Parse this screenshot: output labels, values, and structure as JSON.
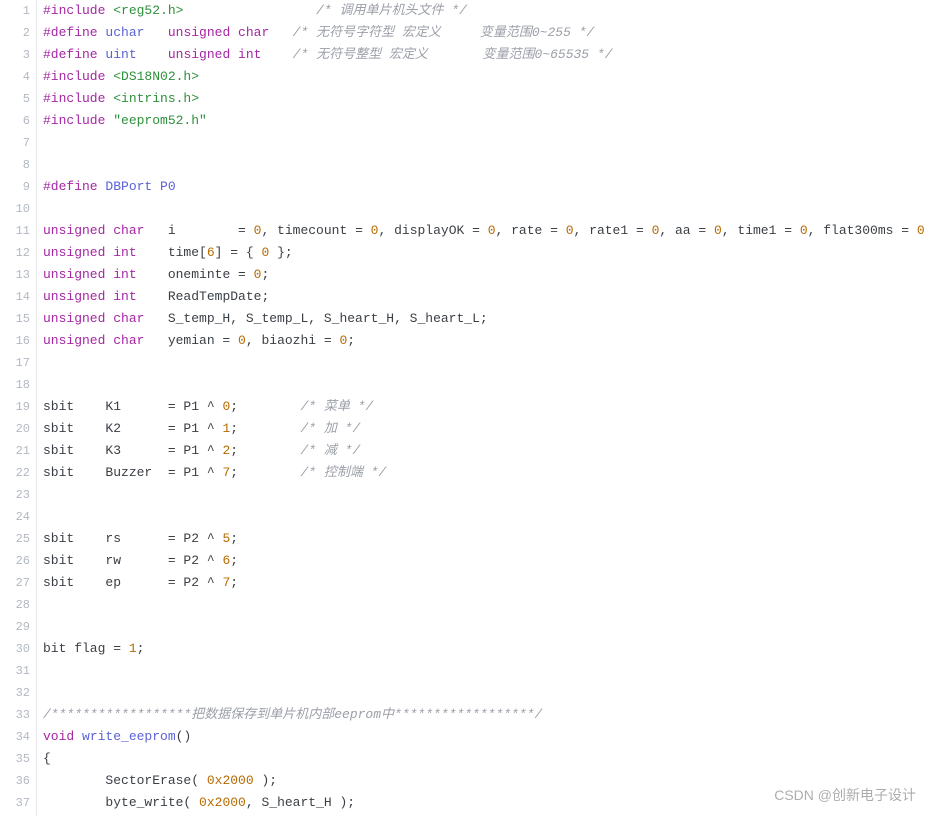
{
  "watermark": "CSDN @创新电子设计",
  "lines": [
    {
      "n": 1,
      "indent": 0,
      "segs": [
        {
          "c": "kw2",
          "t": "#include "
        },
        {
          "c": "inc",
          "t": "<reg52.h>                 "
        },
        {
          "c": "cmt",
          "t": "/* 调用单片机头文件 */"
        }
      ]
    },
    {
      "n": 2,
      "indent": 0,
      "segs": [
        {
          "c": "kw2",
          "t": "#define "
        },
        {
          "c": "mac",
          "t": "uchar   "
        },
        {
          "c": "kw1",
          "t": "unsigned char   "
        },
        {
          "c": "cmt",
          "t": "/* 无符号字符型 宏定义     变量范围0~255 */"
        }
      ]
    },
    {
      "n": 3,
      "indent": 0,
      "segs": [
        {
          "c": "kw2",
          "t": "#define "
        },
        {
          "c": "mac",
          "t": "uint    "
        },
        {
          "c": "kw1",
          "t": "unsigned int    "
        },
        {
          "c": "cmt",
          "t": "/* 无符号整型 宏定义       变量范围0~65535 */"
        }
      ]
    },
    {
      "n": 4,
      "indent": 0,
      "segs": [
        {
          "c": "kw2",
          "t": "#include "
        },
        {
          "c": "inc",
          "t": "<DS18N02.h>"
        }
      ]
    },
    {
      "n": 5,
      "indent": 0,
      "segs": [
        {
          "c": "kw2",
          "t": "#include "
        },
        {
          "c": "inc",
          "t": "<intrins.h>"
        }
      ]
    },
    {
      "n": 6,
      "indent": 0,
      "segs": [
        {
          "c": "kw2",
          "t": "#include "
        },
        {
          "c": "inc",
          "t": "\"eeprom52.h\""
        }
      ]
    },
    {
      "n": 7,
      "indent": 0,
      "segs": []
    },
    {
      "n": 8,
      "indent": 0,
      "segs": []
    },
    {
      "n": 9,
      "indent": 0,
      "segs": [
        {
          "c": "kw2",
          "t": "#define "
        },
        {
          "c": "mac",
          "t": "DBPort P0"
        }
      ]
    },
    {
      "n": 10,
      "indent": 0,
      "segs": []
    },
    {
      "n": 11,
      "indent": 0,
      "segs": [
        {
          "c": "kw1",
          "t": "unsigned char"
        },
        {
          "c": "id",
          "t": "   i        = "
        },
        {
          "c": "num",
          "t": "0"
        },
        {
          "c": "id",
          "t": ", timecount = "
        },
        {
          "c": "num",
          "t": "0"
        },
        {
          "c": "id",
          "t": ", displayOK = "
        },
        {
          "c": "num",
          "t": "0"
        },
        {
          "c": "id",
          "t": ", rate = "
        },
        {
          "c": "num",
          "t": "0"
        },
        {
          "c": "id",
          "t": ", rate1 = "
        },
        {
          "c": "num",
          "t": "0"
        },
        {
          "c": "id",
          "t": ", aa = "
        },
        {
          "c": "num",
          "t": "0"
        },
        {
          "c": "id",
          "t": ", time1 = "
        },
        {
          "c": "num",
          "t": "0"
        },
        {
          "c": "id",
          "t": ", flat300ms = "
        },
        {
          "c": "num",
          "t": "0"
        },
        {
          "c": "id",
          "t": ";"
        }
      ]
    },
    {
      "n": 12,
      "indent": 0,
      "segs": [
        {
          "c": "kw1",
          "t": "unsigned int"
        },
        {
          "c": "id",
          "t": "    time["
        },
        {
          "c": "num",
          "t": "6"
        },
        {
          "c": "id",
          "t": "] = { "
        },
        {
          "c": "num",
          "t": "0"
        },
        {
          "c": "id",
          "t": " };"
        }
      ]
    },
    {
      "n": 13,
      "indent": 0,
      "segs": [
        {
          "c": "kw1",
          "t": "unsigned int"
        },
        {
          "c": "id",
          "t": "    oneminte = "
        },
        {
          "c": "num",
          "t": "0"
        },
        {
          "c": "id",
          "t": ";"
        }
      ]
    },
    {
      "n": 14,
      "indent": 0,
      "segs": [
        {
          "c": "kw1",
          "t": "unsigned int"
        },
        {
          "c": "id",
          "t": "    ReadTempDate;"
        }
      ]
    },
    {
      "n": 15,
      "indent": 0,
      "segs": [
        {
          "c": "kw1",
          "t": "unsigned char"
        },
        {
          "c": "id",
          "t": "   S_temp_H, S_temp_L, S_heart_H, S_heart_L;"
        }
      ]
    },
    {
      "n": 16,
      "indent": 0,
      "segs": [
        {
          "c": "kw1",
          "t": "unsigned char"
        },
        {
          "c": "id",
          "t": "   yemian = "
        },
        {
          "c": "num",
          "t": "0"
        },
        {
          "c": "id",
          "t": ", biaozhi = "
        },
        {
          "c": "num",
          "t": "0"
        },
        {
          "c": "id",
          "t": ";"
        }
      ]
    },
    {
      "n": 17,
      "indent": 0,
      "segs": []
    },
    {
      "n": 18,
      "indent": 0,
      "segs": []
    },
    {
      "n": 19,
      "indent": 0,
      "segs": [
        {
          "c": "id",
          "t": "sbit    K1      = P1 ^ "
        },
        {
          "c": "num",
          "t": "0"
        },
        {
          "c": "id",
          "t": ";        "
        },
        {
          "c": "cmt",
          "t": "/* 菜单 */"
        }
      ]
    },
    {
      "n": 20,
      "indent": 0,
      "segs": [
        {
          "c": "id",
          "t": "sbit    K2      = P1 ^ "
        },
        {
          "c": "num",
          "t": "1"
        },
        {
          "c": "id",
          "t": ";        "
        },
        {
          "c": "cmt",
          "t": "/* 加 */"
        }
      ]
    },
    {
      "n": 21,
      "indent": 0,
      "segs": [
        {
          "c": "id",
          "t": "sbit    K3      = P1 ^ "
        },
        {
          "c": "num",
          "t": "2"
        },
        {
          "c": "id",
          "t": ";        "
        },
        {
          "c": "cmt",
          "t": "/* 减 */"
        }
      ]
    },
    {
      "n": 22,
      "indent": 0,
      "segs": [
        {
          "c": "id",
          "t": "sbit    Buzzer  = P1 ^ "
        },
        {
          "c": "num",
          "t": "7"
        },
        {
          "c": "id",
          "t": ";        "
        },
        {
          "c": "cmt",
          "t": "/* 控制端 */"
        }
      ]
    },
    {
      "n": 23,
      "indent": 0,
      "segs": []
    },
    {
      "n": 24,
      "indent": 0,
      "segs": []
    },
    {
      "n": 25,
      "indent": 0,
      "segs": [
        {
          "c": "id",
          "t": "sbit    rs      = P2 ^ "
        },
        {
          "c": "num",
          "t": "5"
        },
        {
          "c": "id",
          "t": ";"
        }
      ]
    },
    {
      "n": 26,
      "indent": 0,
      "segs": [
        {
          "c": "id",
          "t": "sbit    rw      = P2 ^ "
        },
        {
          "c": "num",
          "t": "6"
        },
        {
          "c": "id",
          "t": ";"
        }
      ]
    },
    {
      "n": 27,
      "indent": 0,
      "segs": [
        {
          "c": "id",
          "t": "sbit    ep      = P2 ^ "
        },
        {
          "c": "num",
          "t": "7"
        },
        {
          "c": "id",
          "t": ";"
        }
      ]
    },
    {
      "n": 28,
      "indent": 0,
      "segs": []
    },
    {
      "n": 29,
      "indent": 0,
      "segs": []
    },
    {
      "n": 30,
      "indent": 0,
      "segs": [
        {
          "c": "id",
          "t": "bit flag = "
        },
        {
          "c": "num",
          "t": "1"
        },
        {
          "c": "id",
          "t": ";"
        }
      ]
    },
    {
      "n": 31,
      "indent": 0,
      "segs": []
    },
    {
      "n": 32,
      "indent": 0,
      "segs": []
    },
    {
      "n": 33,
      "indent": 0,
      "segs": [
        {
          "c": "cmt",
          "t": "/******************把数据保存到单片机内部eeprom中******************/"
        }
      ]
    },
    {
      "n": 34,
      "indent": 0,
      "segs": [
        {
          "c": "kw1",
          "t": "void "
        },
        {
          "c": "mac",
          "t": "write_eeprom"
        },
        {
          "c": "id",
          "t": "()"
        }
      ]
    },
    {
      "n": 35,
      "indent": 0,
      "segs": [
        {
          "c": "id",
          "t": "{"
        }
      ]
    },
    {
      "n": 36,
      "indent": 8,
      "segs": [
        {
          "c": "id",
          "t": "SectorErase( "
        },
        {
          "c": "num",
          "t": "0x2000"
        },
        {
          "c": "id",
          "t": " );"
        }
      ]
    },
    {
      "n": 37,
      "indent": 8,
      "segs": [
        {
          "c": "id",
          "t": "byte_write( "
        },
        {
          "c": "num",
          "t": "0x2000"
        },
        {
          "c": "id",
          "t": ", S_heart_H );"
        }
      ]
    }
  ]
}
